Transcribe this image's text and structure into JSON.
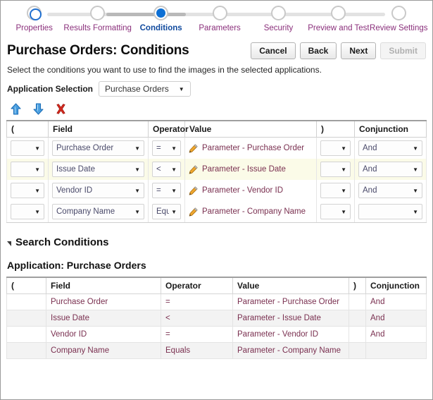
{
  "train": {
    "steps": [
      {
        "label": "Properties",
        "state": "visited"
      },
      {
        "label": "Results Formatting",
        "state": "visited-gray"
      },
      {
        "label": "Conditions",
        "state": "current"
      },
      {
        "label": "Parameters",
        "state": "pending"
      },
      {
        "label": "Security",
        "state": "pending"
      },
      {
        "label": "Preview and Test",
        "state": "pending"
      },
      {
        "label": "Review Settings",
        "state": "pending"
      }
    ]
  },
  "header": {
    "title": "Purchase Orders: Conditions",
    "subtitle": "Select the conditions you want to use to find the images in the selected applications.",
    "buttons": {
      "cancel": "Cancel",
      "back": "Back",
      "next": "Next",
      "submit": "Submit"
    }
  },
  "application_selection": {
    "label": "Application Selection",
    "value": "Purchase Orders",
    "caret": "▼"
  },
  "toolbar": {
    "move_up": "move-up",
    "move_down": "move-down",
    "delete": "delete"
  },
  "conditions_table": {
    "columns": [
      "(",
      "Field",
      "Operator",
      "Value",
      ")",
      "Conjunction"
    ],
    "rows": [
      {
        "open_paren": "",
        "field": "Purchase Order",
        "operator": "=",
        "value": "Parameter - Purchase Order",
        "close_paren": "",
        "conjunction": "And",
        "selected": false
      },
      {
        "open_paren": "",
        "field": "Issue Date",
        "operator": "<",
        "value": "Parameter - Issue Date",
        "close_paren": "",
        "conjunction": "And",
        "selected": true
      },
      {
        "open_paren": "",
        "field": "Vendor ID",
        "operator": "=",
        "value": "Parameter - Vendor ID",
        "close_paren": "",
        "conjunction": "And",
        "selected": false
      },
      {
        "open_paren": "",
        "field": "Company Name",
        "operator": "Equals",
        "value": "Parameter - Company Name",
        "close_paren": "",
        "conjunction": "",
        "selected": false
      }
    ]
  },
  "search_conditions": {
    "title": "Search Conditions",
    "application_line": "Application: Purchase Orders",
    "columns": [
      "(",
      "Field",
      "Operator",
      "Value",
      ")",
      "Conjunction"
    ],
    "rows": [
      {
        "open_paren": "",
        "field": "Purchase Order",
        "operator": "=",
        "value": "Parameter - Purchase Order",
        "close_paren": "",
        "conjunction": "And"
      },
      {
        "open_paren": "",
        "field": "Issue Date",
        "operator": "<",
        "value": "Parameter - Issue Date",
        "close_paren": "",
        "conjunction": "And"
      },
      {
        "open_paren": "",
        "field": "Vendor ID",
        "operator": "=",
        "value": "Parameter - Vendor ID",
        "close_paren": "",
        "conjunction": "And"
      },
      {
        "open_paren": "",
        "field": "Company Name",
        "operator": "Equals",
        "value": "Parameter - Company Name",
        "close_paren": "",
        "conjunction": ""
      }
    ]
  },
  "colors": {
    "accent_blue": "#0d6fd4",
    "link_purple": "#8a2f7b",
    "current_label": "#104a9e",
    "value_text": "#7a3050",
    "selected_row": "#fbfbe8",
    "delete_red": "#d42b20"
  }
}
